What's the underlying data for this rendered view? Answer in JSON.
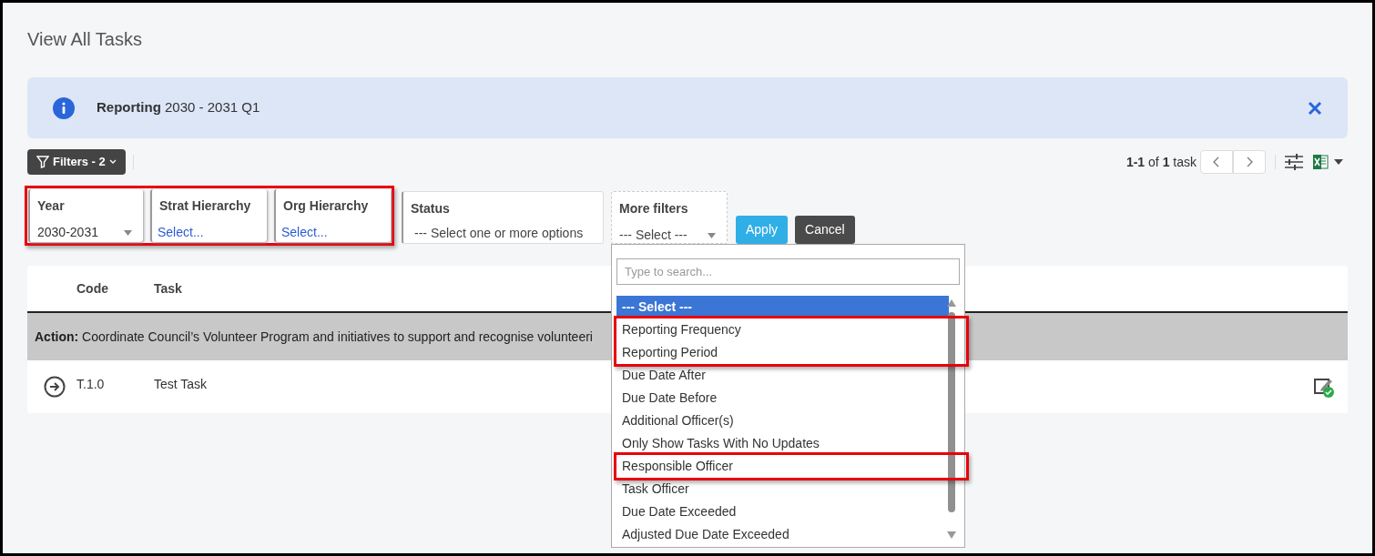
{
  "page_title": "View All Tasks",
  "banner": {
    "label": "Reporting",
    "text": "2030 - 2031 Q1"
  },
  "filters_button": "Filters - 2",
  "pagination": "**1-1** of **1** task",
  "filters": [
    {
      "kind": "dropdown",
      "label": "Year",
      "value": "2030-2031",
      "highlighted": true
    },
    {
      "kind": "picker",
      "label": "Strat Hierarchy",
      "value": "Select...",
      "highlighted": true
    },
    {
      "kind": "picker",
      "label": "Org Hierarchy",
      "value": "Select...",
      "highlighted": true
    },
    {
      "kind": "multiselect",
      "label": "Status",
      "placeholder": "--- Select one or more options",
      "highlighted": false
    },
    {
      "kind": "more",
      "label": "More filters",
      "value": "--- Select ---",
      "highlighted": false,
      "expanded": true
    }
  ],
  "buttons": [
    "Apply",
    "Cancel"
  ],
  "dropdown": {
    "search_placeholder": "Type to search...",
    "options": [
      {
        "label": "--- Select ---",
        "selected": true,
        "highlighted": false
      },
      {
        "label": "Reporting Frequency",
        "selected": false,
        "highlighted": true
      },
      {
        "label": "Reporting Period",
        "selected": false,
        "highlighted": true
      },
      {
        "label": "Due Date After",
        "selected": false,
        "highlighted": false
      },
      {
        "label": "Due Date Before",
        "selected": false,
        "highlighted": false
      },
      {
        "label": "Additional Officer(s)",
        "selected": false,
        "highlighted": false
      },
      {
        "label": "Only Show Tasks With No Updates",
        "selected": false,
        "highlighted": false
      },
      {
        "label": "Responsible Officer",
        "selected": false,
        "highlighted": true
      },
      {
        "label": "Task Officer",
        "selected": false,
        "highlighted": false
      },
      {
        "label": "Due Date Exceeded",
        "selected": false,
        "highlighted": false
      },
      {
        "label": "Adjusted Due Date Exceeded",
        "selected": false,
        "highlighted": false
      }
    ]
  },
  "table": {
    "columns": [
      "Code",
      "Task"
    ],
    "group": {
      "label": "Action:",
      "text": "Coordinate Council’s Volunteer Program and initiatives to support and recognise volunteeri"
    },
    "rows": [
      {
        "code": "T.1.0",
        "task": "Test Task"
      }
    ]
  }
}
